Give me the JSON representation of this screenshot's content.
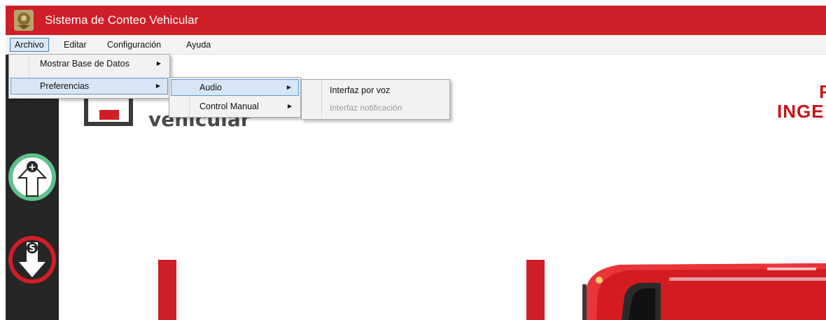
{
  "window": {
    "title": "Sistema de Conteo Vehicular"
  },
  "menubar": {
    "items": [
      {
        "label": "Archivo"
      },
      {
        "label": "Editar"
      },
      {
        "label": "Configuración"
      },
      {
        "label": "Ayuda"
      }
    ]
  },
  "archivo_menu": {
    "items": [
      {
        "label": "Mostrar Base de Datos"
      },
      {
        "label": "Preferencias"
      }
    ]
  },
  "preferencias_menu": {
    "items": [
      {
        "label": "Audio"
      },
      {
        "label": "Control Manual"
      }
    ]
  },
  "audio_menu": {
    "items": [
      {
        "label": "Interfaz por voz",
        "enabled": true
      },
      {
        "label": "Interfaz notificación",
        "enabled": false
      }
    ]
  },
  "sidebar": {
    "buttons": [
      {
        "symbol": "+",
        "icon": "entry-count-icon"
      },
      {
        "symbol": "S",
        "icon": "exit-count-icon"
      }
    ]
  },
  "content": {
    "logo_text": "vehicular",
    "brand_line1": "F",
    "brand_line2": "INGE"
  },
  "colors": {
    "titlebar": "#d01e26",
    "sidebar": "#262626",
    "entry_ring": "#5fc08a",
    "exit_ring": "#d01e26",
    "menu_highlight": "#d6e6f6"
  }
}
